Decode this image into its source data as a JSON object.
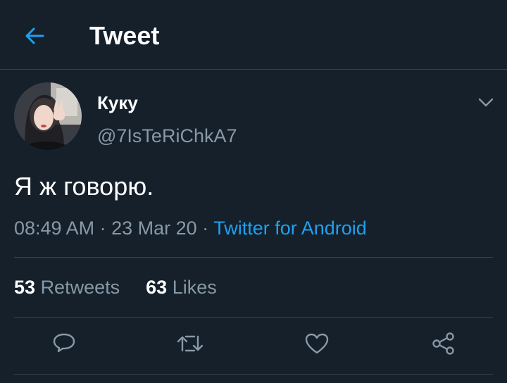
{
  "header": {
    "title": "Tweet",
    "back_icon": "arrow-left-icon",
    "accent": "#1da1f2"
  },
  "author": {
    "display_name": "Куку",
    "handle": "@7IsTeRiChkA7"
  },
  "tweet": {
    "text": "Я ж говорю.",
    "time": "08:49 AM",
    "date": "23 Mar 20",
    "separator": "·",
    "source": "Twitter for Android"
  },
  "stats": {
    "retweets_count": "53",
    "retweets_label": "Retweets",
    "likes_count": "63",
    "likes_label": "Likes"
  },
  "actions": [
    "reply-icon",
    "retweet-icon",
    "like-icon",
    "share-icon"
  ],
  "colors": {
    "background": "#15202b",
    "divider": "#38444d",
    "muted": "#8899a6",
    "link": "#1da1f2"
  }
}
